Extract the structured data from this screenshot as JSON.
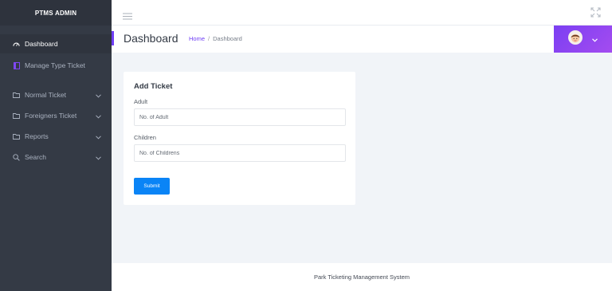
{
  "sidebar": {
    "brand": "PTMS ADMIN",
    "items": [
      {
        "label": "Dashboard",
        "icon": "dashboard-icon",
        "active": true
      },
      {
        "label": "Manage Type Ticket",
        "icon": "book-icon"
      },
      {
        "label": "Normal Ticket",
        "icon": "folder-icon",
        "expandable": true
      },
      {
        "label": "Foreigners Ticket",
        "icon": "folder-icon",
        "expandable": true
      },
      {
        "label": "Reports",
        "icon": "folder-icon",
        "expandable": true
      },
      {
        "label": "Search",
        "icon": "search-icon",
        "expandable": true
      }
    ]
  },
  "header": {
    "title": "Dashboard",
    "breadcrumb": {
      "home": "Home",
      "separator": "/",
      "current": "Dashboard"
    }
  },
  "form": {
    "title": "Add Ticket",
    "adult": {
      "label": "Adult",
      "placeholder": "No. of Adult"
    },
    "children": {
      "label": "Children",
      "placeholder": "No. of Childrens"
    },
    "submit_label": "Submit"
  },
  "footer": {
    "text": "Park Ticketing Management System"
  },
  "colors": {
    "accent": "#6f3ef5",
    "sidebar": "#343a45",
    "button": "#0a84f6"
  }
}
